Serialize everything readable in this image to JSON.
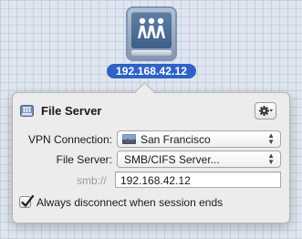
{
  "desktop": {
    "server_icon": "file-server-icon",
    "ip_label": "192.168.42.12"
  },
  "popover": {
    "title": "File Server",
    "title_icon": "file-server-small-icon",
    "gear_icon": "gear-icon",
    "vpn": {
      "label": "VPN Connection:",
      "value": "San Francisco",
      "icon": "san-francisco-flag-icon"
    },
    "file_server": {
      "label": "File Server:",
      "value": "SMB/CIFS Server..."
    },
    "address": {
      "prefix": "smb://",
      "value": "192.168.42.12"
    },
    "disconnect": {
      "label": "Always disconnect when session ends",
      "checked": true
    }
  },
  "colors": {
    "accent": "#2f62c7",
    "popover_bg": "#ececec",
    "desktop_bg": "#dfe6ef"
  }
}
